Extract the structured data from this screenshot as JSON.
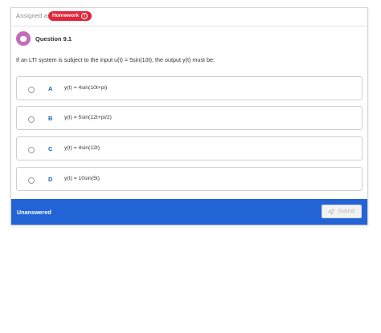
{
  "header": {
    "assigned_label": "Assigned as",
    "badge_label": "Homework"
  },
  "question": {
    "title": "Question 9.1",
    "text": "If an LTI system is subject to the input u(t) = 5sin(10t), the output y(t) must be:"
  },
  "options": [
    {
      "letter": "A",
      "text": "y(t) = 4sin(10t+pi)"
    },
    {
      "letter": "B",
      "text": "y(t) = 5sin(12t+pi/2)"
    },
    {
      "letter": "C",
      "text": "y(t) = 4sin(12t)"
    },
    {
      "letter": "D",
      "text": "y(t) = 10sin(5t)"
    }
  ],
  "footer": {
    "status": "Unanswered",
    "submit_label": "Submit"
  },
  "colors": {
    "badge": "#e0263a",
    "footer": "#2264d6",
    "accent_letter": "#1a5fb4",
    "question_icon": "#c46bbb"
  },
  "icons": {
    "badge_info": "info-icon",
    "question": "question-bubble-icon",
    "submit": "send-icon"
  }
}
